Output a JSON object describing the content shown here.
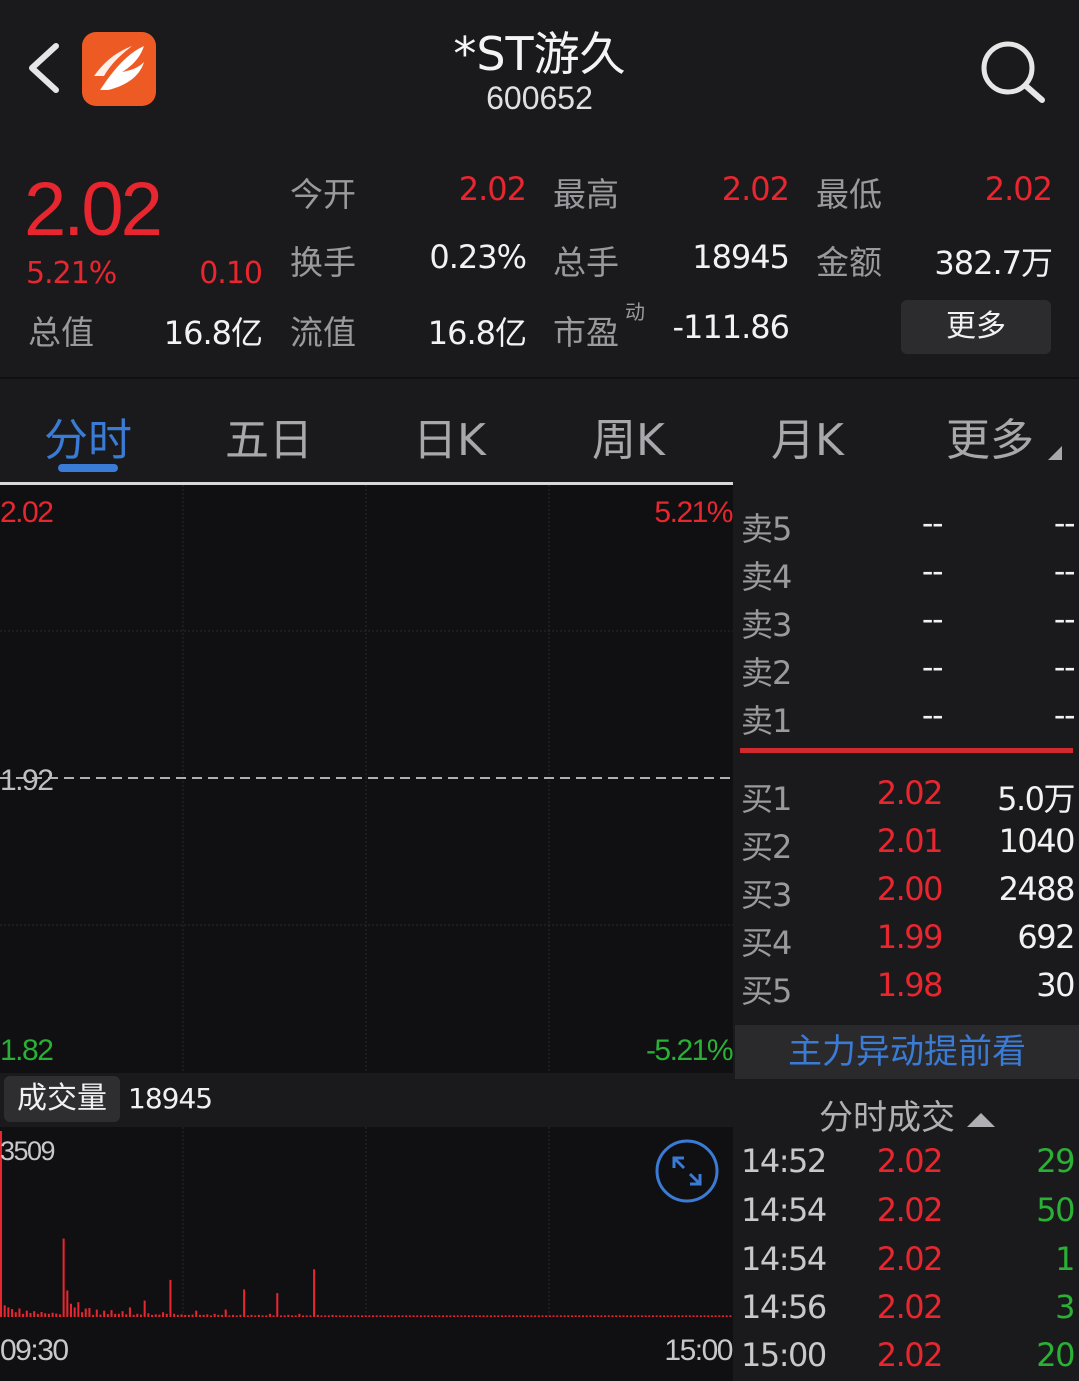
{
  "header": {
    "stock_name": "*ST游久",
    "stock_code": "600652",
    "back_icon": "chevron-left-icon",
    "search_icon": "search-icon",
    "logo_icon": "app-logo-icon"
  },
  "quote": {
    "last_price": "2.02",
    "change_pct": "5.21%",
    "change_amt": "0.10",
    "total_value_label": "总值",
    "total_value": "16.8亿",
    "fields": [
      {
        "label": "今开",
        "value": "2.02"
      },
      {
        "label": "最高",
        "value": "2.02"
      },
      {
        "label": "最低",
        "value": "2.02"
      },
      {
        "label": "换手",
        "value": "0.23%"
      },
      {
        "label": "总手",
        "value": "18945"
      },
      {
        "label": "金额",
        "value": "382.7万"
      },
      {
        "label": "流值",
        "value": "16.8亿"
      },
      {
        "label": "市盈",
        "value": "-111.86"
      }
    ],
    "pe_superscript": "动",
    "more_label": "更多"
  },
  "tabs": [
    {
      "label": "分时",
      "active": true
    },
    {
      "label": "五日",
      "active": false
    },
    {
      "label": "日K",
      "active": false
    },
    {
      "label": "周K",
      "active": false
    },
    {
      "label": "月K",
      "active": false
    },
    {
      "label": "更多",
      "active": false
    }
  ],
  "chart": {
    "price_high": "2.02",
    "pct_high": "5.21%",
    "price_mid": "1.92",
    "price_low": "1.82",
    "pct_low": "-5.21%",
    "volume_label": "成交量",
    "volume_total": "18945",
    "volume_axis_max": "3509",
    "time_start": "09:30",
    "time_end": "15:00",
    "expand_icon": "expand-arrows-icon"
  },
  "chart_data": {
    "type": "bar",
    "title": "成交量",
    "x": [
      "09:30",
      "15:00"
    ],
    "ylim": [
      0,
      3509
    ],
    "values": [
      3509,
      220,
      180,
      150,
      90,
      160,
      60,
      120,
      75,
      110,
      60,
      95,
      70,
      60,
      80,
      65,
      50,
      1480,
      500,
      250,
      180,
      280,
      90,
      160,
      170,
      40,
      140,
      45,
      120,
      55,
      130,
      60,
      60,
      110,
      50,
      180,
      40,
      60,
      45,
      310,
      70,
      40,
      50,
      45,
      90,
      60,
      700,
      60,
      40,
      50,
      40,
      40,
      45,
      120,
      40,
      40,
      50,
      30,
      60,
      40,
      40,
      140,
      30,
      40,
      30,
      40,
      520,
      30,
      40,
      30,
      40,
      30,
      30,
      60,
      30,
      450,
      30,
      30,
      40,
      30,
      30,
      60,
      30,
      30,
      30,
      900,
      40,
      30,
      30,
      30,
      40,
      30,
      30,
      30,
      30,
      30,
      30,
      30,
      30,
      30,
      30,
      30,
      30,
      30,
      30,
      30,
      30,
      30,
      30,
      30,
      30,
      30,
      30,
      30,
      30,
      30,
      30,
      30,
      30,
      30,
      30,
      30,
      30,
      30,
      30,
      30,
      30,
      30,
      30,
      30,
      30,
      30,
      30,
      30,
      30,
      30,
      30,
      30,
      30,
      30,
      30,
      30,
      30,
      30,
      30,
      30,
      30,
      30,
      30,
      30,
      30,
      30,
      30,
      30,
      30,
      30,
      30,
      30,
      30,
      30,
      30,
      30,
      30,
      30,
      30,
      30,
      30,
      30,
      30,
      30,
      30,
      30,
      30,
      30,
      30,
      30,
      30,
      30,
      30,
      30,
      30,
      30,
      30,
      30,
      30,
      30,
      30,
      30,
      30,
      30,
      30,
      30,
      30,
      30,
      30,
      30,
      30,
      30,
      30
    ]
  },
  "order_book": {
    "asks": [
      {
        "label": "卖5",
        "price": "--",
        "volume": "--"
      },
      {
        "label": "卖4",
        "price": "--",
        "volume": "--"
      },
      {
        "label": "卖3",
        "price": "--",
        "volume": "--"
      },
      {
        "label": "卖2",
        "price": "--",
        "volume": "--"
      },
      {
        "label": "卖1",
        "price": "--",
        "volume": "--"
      }
    ],
    "bids": [
      {
        "label": "买1",
        "price": "2.02",
        "volume": "5.0万"
      },
      {
        "label": "买2",
        "price": "2.01",
        "volume": "1040"
      },
      {
        "label": "买3",
        "price": "2.00",
        "volume": "2488"
      },
      {
        "label": "买4",
        "price": "1.99",
        "volume": "692"
      },
      {
        "label": "买5",
        "price": "1.98",
        "volume": "30"
      }
    ]
  },
  "promo": {
    "label": "主力异动提前看"
  },
  "ticks": {
    "header": "分时成交",
    "rows": [
      {
        "time": "14:52",
        "price": "2.02",
        "volume": "29"
      },
      {
        "time": "14:54",
        "price": "2.02",
        "volume": "50"
      },
      {
        "time": "14:54",
        "price": "2.02",
        "volume": "1"
      },
      {
        "time": "14:56",
        "price": "2.02",
        "volume": "3"
      },
      {
        "time": "15:00",
        "price": "2.02",
        "volume": "20"
      }
    ]
  },
  "colors": {
    "up": "#e8262f",
    "down": "#2ab034",
    "accent": "#3a7bd5",
    "background": "#1a1a1c",
    "chart_background": "#101012"
  }
}
